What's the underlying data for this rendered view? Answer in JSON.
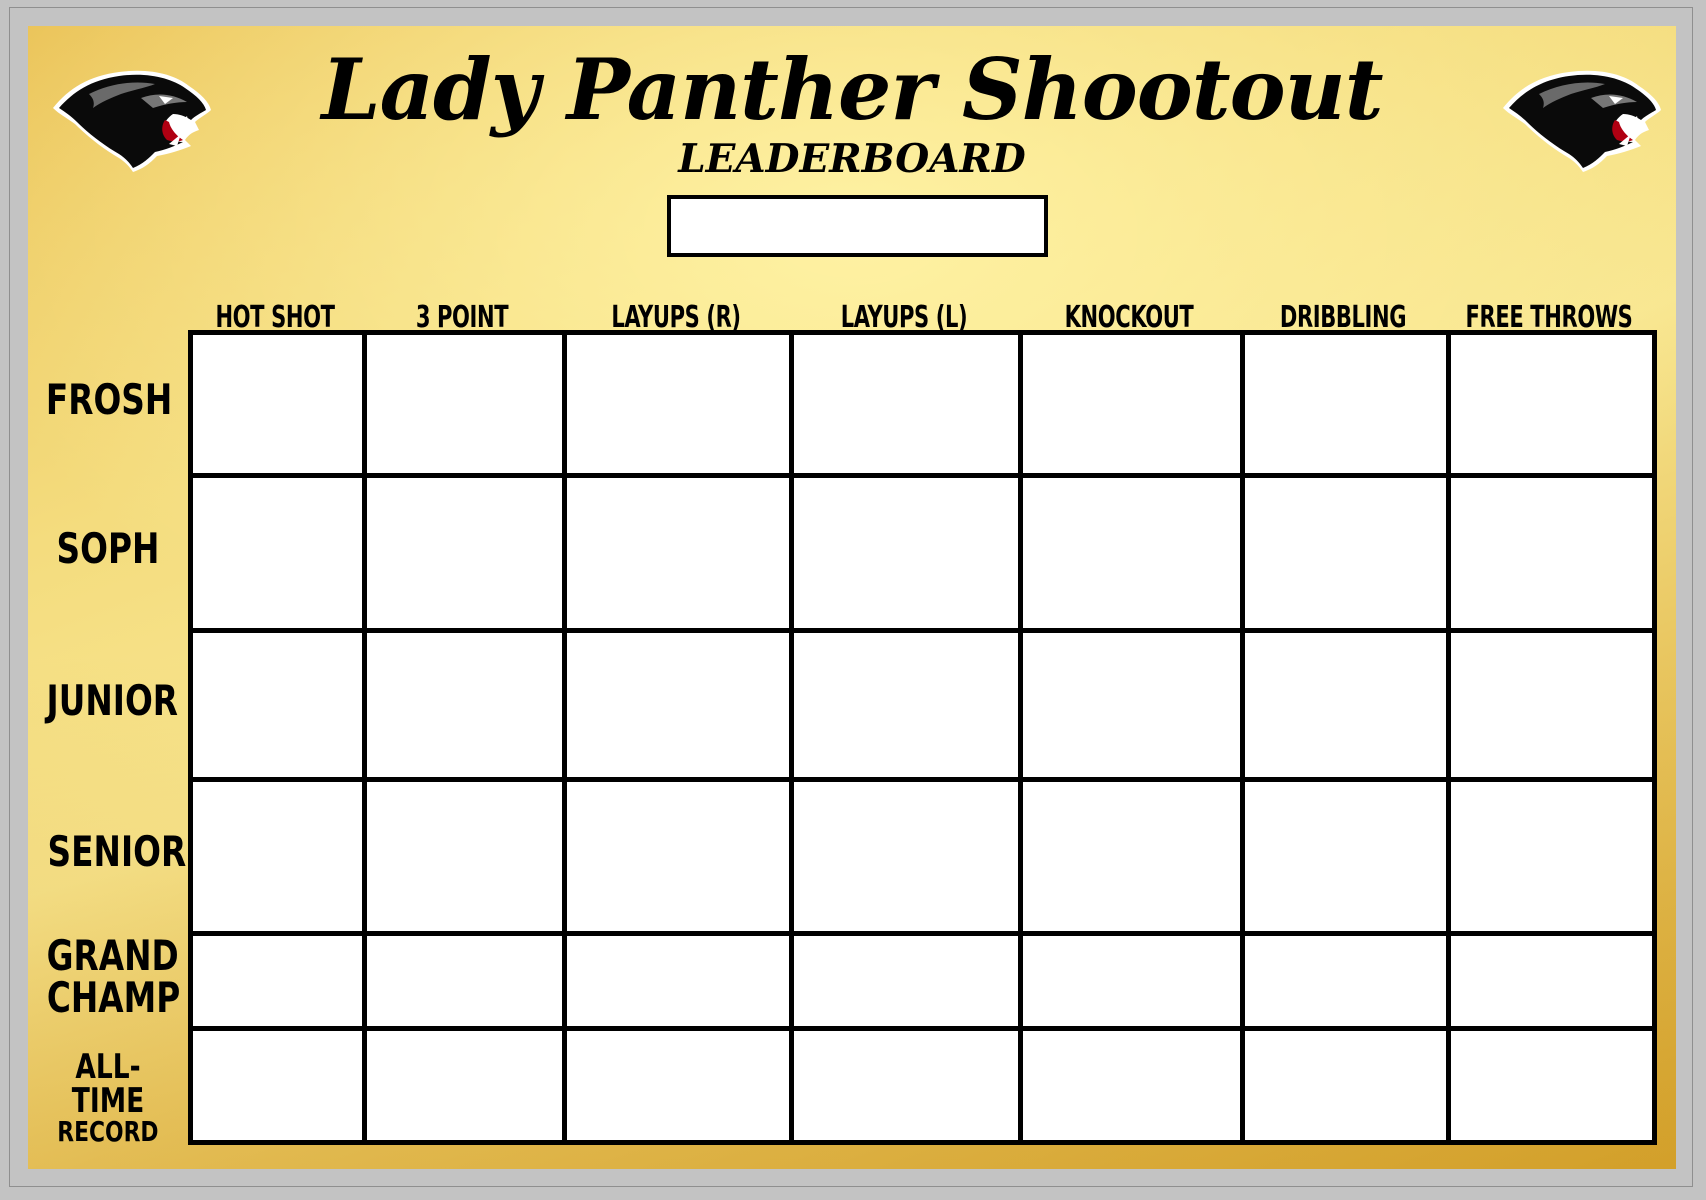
{
  "title": "Lady Panther Shootout",
  "subtitle": "LEADERBOARD",
  "date_box": {
    "value": ""
  },
  "logos": {
    "left": "panther-mascot",
    "right": "panther-mascot"
  },
  "columns": [
    "Hot Shot",
    "3 Point",
    "Layups (R)",
    "Layups (L)",
    "Knockout",
    "Dribbling",
    "Free Throws"
  ],
  "rows": [
    {
      "label": [
        "Frosh"
      ],
      "size": "big"
    },
    {
      "label": [
        "Soph"
      ],
      "size": "big"
    },
    {
      "label": [
        "Junior"
      ],
      "size": "big"
    },
    {
      "label": [
        "Senior"
      ],
      "size": "big"
    },
    {
      "label": [
        "Grand",
        "Champ"
      ],
      "size": "big"
    },
    {
      "label": [
        "All-Time",
        "Record"
      ],
      "size": "mixed"
    }
  ],
  "cells": [
    [
      "",
      "",
      "",
      "",
      "",
      "",
      ""
    ],
    [
      "",
      "",
      "",
      "",
      "",
      "",
      ""
    ],
    [
      "",
      "",
      "",
      "",
      "",
      "",
      ""
    ],
    [
      "",
      "",
      "",
      "",
      "",
      "",
      ""
    ],
    [
      "",
      "",
      "",
      "",
      "",
      "",
      ""
    ],
    [
      "",
      "",
      "",
      "",
      "",
      "",
      ""
    ]
  ],
  "colors": {
    "gold_light": "#f8e690",
    "gold_dark": "#d6a631",
    "frame": "#c3c3c3",
    "ink": "#000000",
    "cell": "#ffffff"
  }
}
